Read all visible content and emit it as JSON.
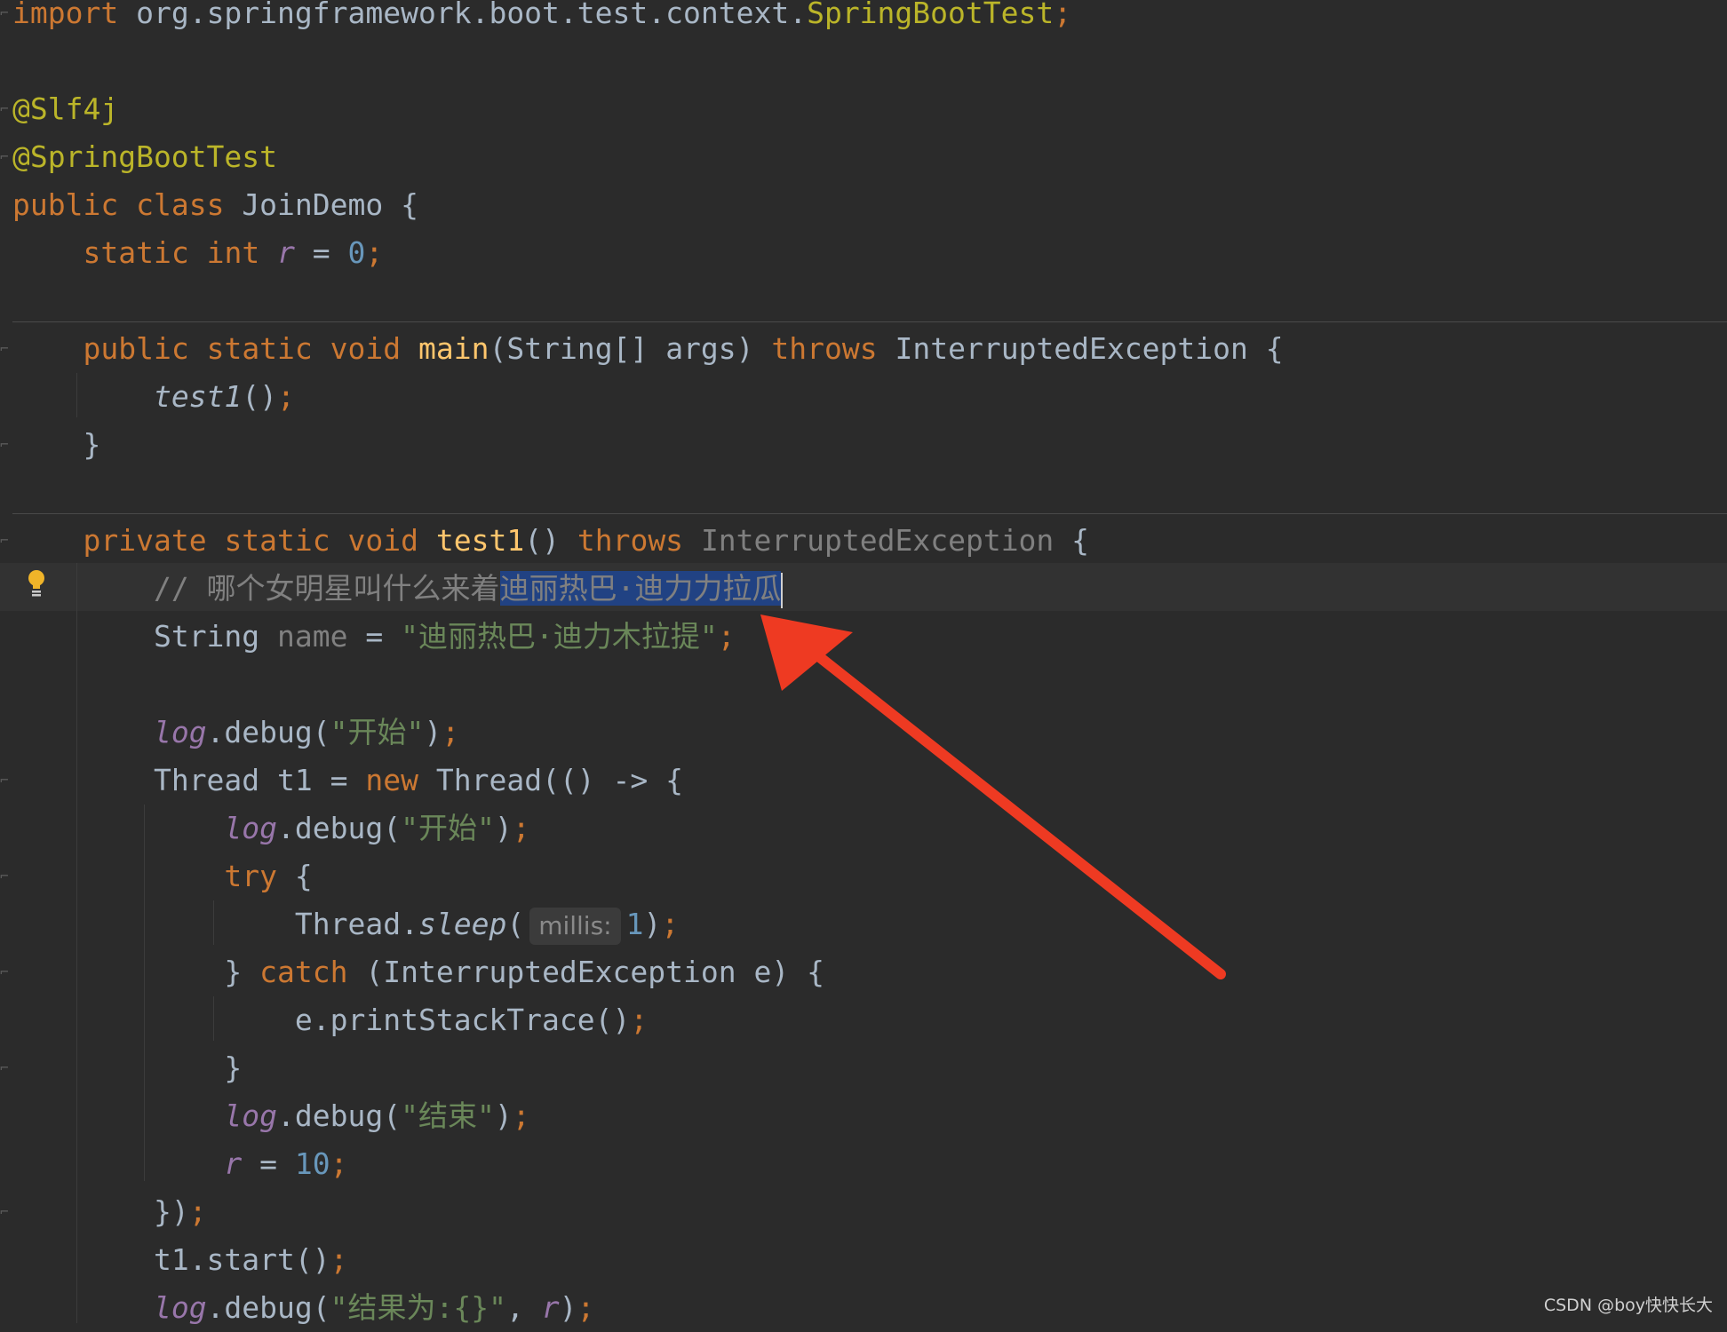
{
  "code": {
    "import_kw": "import",
    "import_path": "org.springframework.boot.test.context.",
    "import_class": "SpringBootTest",
    "semicolon": ";",
    "ann_slf4j": "@Slf4j",
    "ann_springboot": "@SpringBootTest",
    "kw_public": "public",
    "kw_class": "class",
    "kw_static": "static",
    "kw_int": "int",
    "kw_void": "void",
    "kw_private": "private",
    "kw_throws": "throws",
    "kw_new": "new",
    "kw_try": "try",
    "kw_catch": "catch",
    "class_name": "JoinDemo",
    "field_r": "r",
    "num_zero": "0",
    "num_one": "1",
    "num_ten": "10",
    "method_main": "main",
    "main_params": "(String[] args) ",
    "exception_type": "InterruptedException",
    "method_test1": "test1",
    "call_test1": "test1",
    "comment_prefix": "// 哪个女明星叫什么来着",
    "comment_selected": "迪丽热巴·迪力力拉瓜",
    "string_type": "String",
    "var_name": "name",
    "name_value": "\"迪丽热巴·迪力木拉提\"",
    "log_field": "log",
    "debug_call": ".debug(",
    "str_start": "\"开始\"",
    "str_end": "\"结束\"",
    "str_result": "\"结果为:{}\"",
    "thread_decl": "Thread t1 = ",
    "thread_ctor": "Thread(() -> {",
    "thread_sleep_obj": "Thread.",
    "sleep_method": "sleep",
    "param_hint": "millis:",
    "catch_params": "(InterruptedException e) {",
    "print_stack": "e.printStackTrace()",
    "close_lambda": "})",
    "start_call": "t1.start()",
    "brace_open": "{",
    "brace_close": "}"
  },
  "watermark": "CSDN @boy快快长大"
}
